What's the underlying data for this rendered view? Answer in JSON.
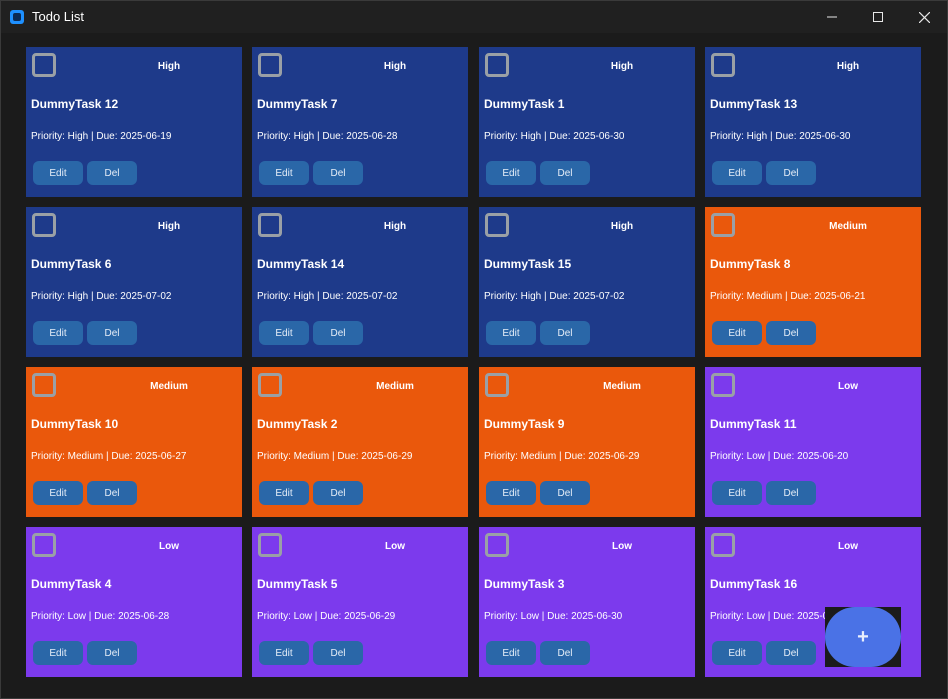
{
  "window": {
    "title": "Todo List",
    "controls": {
      "minimize": "minimize-icon",
      "maximize": "maximize-icon",
      "close": "close-icon"
    }
  },
  "tasks": [
    {
      "title": "DummyTask 12",
      "priority": "High",
      "meta": "Priority: High | Due: 2025-06-19",
      "edit": "Edit",
      "del": "Del"
    },
    {
      "title": "DummyTask 7",
      "priority": "High",
      "meta": "Priority: High | Due: 2025-06-28",
      "edit": "Edit",
      "del": "Del"
    },
    {
      "title": "DummyTask 1",
      "priority": "High",
      "meta": "Priority: High | Due: 2025-06-30",
      "edit": "Edit",
      "del": "Del"
    },
    {
      "title": "DummyTask 13",
      "priority": "High",
      "meta": "Priority: High | Due: 2025-06-30",
      "edit": "Edit",
      "del": "Del"
    },
    {
      "title": "DummyTask 6",
      "priority": "High",
      "meta": "Priority: High | Due: 2025-07-02",
      "edit": "Edit",
      "del": "Del"
    },
    {
      "title": "DummyTask 14",
      "priority": "High",
      "meta": "Priority: High | Due: 2025-07-02",
      "edit": "Edit",
      "del": "Del"
    },
    {
      "title": "DummyTask 15",
      "priority": "High",
      "meta": "Priority: High | Due: 2025-07-02",
      "edit": "Edit",
      "del": "Del"
    },
    {
      "title": "DummyTask 8",
      "priority": "Medium",
      "meta": "Priority: Medium | Due: 2025-06-21",
      "edit": "Edit",
      "del": "Del"
    },
    {
      "title": "DummyTask 10",
      "priority": "Medium",
      "meta": "Priority: Medium | Due: 2025-06-27",
      "edit": "Edit",
      "del": "Del"
    },
    {
      "title": "DummyTask 2",
      "priority": "Medium",
      "meta": "Priority: Medium | Due: 2025-06-29",
      "edit": "Edit",
      "del": "Del"
    },
    {
      "title": "DummyTask 9",
      "priority": "Medium",
      "meta": "Priority: Medium | Due: 2025-06-29",
      "edit": "Edit",
      "del": "Del"
    },
    {
      "title": "DummyTask 11",
      "priority": "Low",
      "meta": "Priority: Low | Due: 2025-06-20",
      "edit": "Edit",
      "del": "Del"
    },
    {
      "title": "DummyTask 4",
      "priority": "Low",
      "meta": "Priority: Low | Due: 2025-06-28",
      "edit": "Edit",
      "del": "Del"
    },
    {
      "title": "DummyTask 5",
      "priority": "Low",
      "meta": "Priority: Low | Due: 2025-06-29",
      "edit": "Edit",
      "del": "Del"
    },
    {
      "title": "DummyTask 3",
      "priority": "Low",
      "meta": "Priority: Low | Due: 2025-06-30",
      "edit": "Edit",
      "del": "Del"
    },
    {
      "title": "DummyTask 16",
      "priority": "Low",
      "meta": "Priority: Low | Due: 2025-06-30",
      "edit": "Edit",
      "del": "Del"
    }
  ],
  "fab": {
    "label": "+",
    "icon": "plus-icon"
  },
  "colors": {
    "high": "#1e3a8a",
    "medium": "#ea580c",
    "low": "#7c3aed",
    "button": "#2a67a8",
    "fab": "#4a72e6"
  }
}
